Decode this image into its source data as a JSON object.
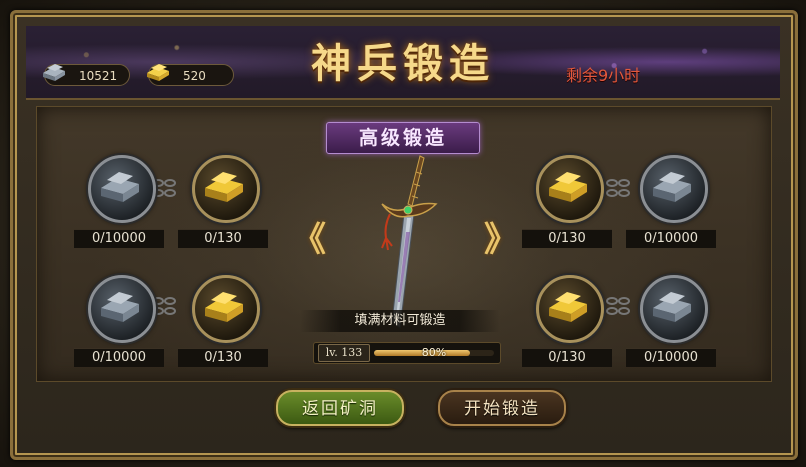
{
  "window": {
    "title": "神兵锻造",
    "remaining_time": "剩余9小时"
  },
  "resources": {
    "silver": {
      "icon": "silver-ingot-icon",
      "value": "10521"
    },
    "gold": {
      "icon": "gold-ingot-icon",
      "value": "520"
    }
  },
  "forge": {
    "level_title": "高级锻造",
    "hint": "填满材料可锻造",
    "level_label": "lv. 133",
    "progress_text": "80%",
    "progress_percent": 80,
    "left_arrow": "《",
    "right_arrow": "》"
  },
  "materials": {
    "left_top_silver": "0/10000",
    "left_top_gold": "0/130",
    "left_bottom_silver": "0/10000",
    "left_bottom_gold": "0/130",
    "right_top_gold": "0/130",
    "right_top_silver": "0/10000",
    "right_bottom_gold": "0/130",
    "right_bottom_silver": "0/10000"
  },
  "buttons": {
    "return": "返回矿洞",
    "forge": "开始锻造"
  },
  "colors": {
    "title": "#f6d98a",
    "remaining": "#e2583d",
    "subtitle_bg": "#6a3a7e",
    "progress": "#f0c870"
  }
}
